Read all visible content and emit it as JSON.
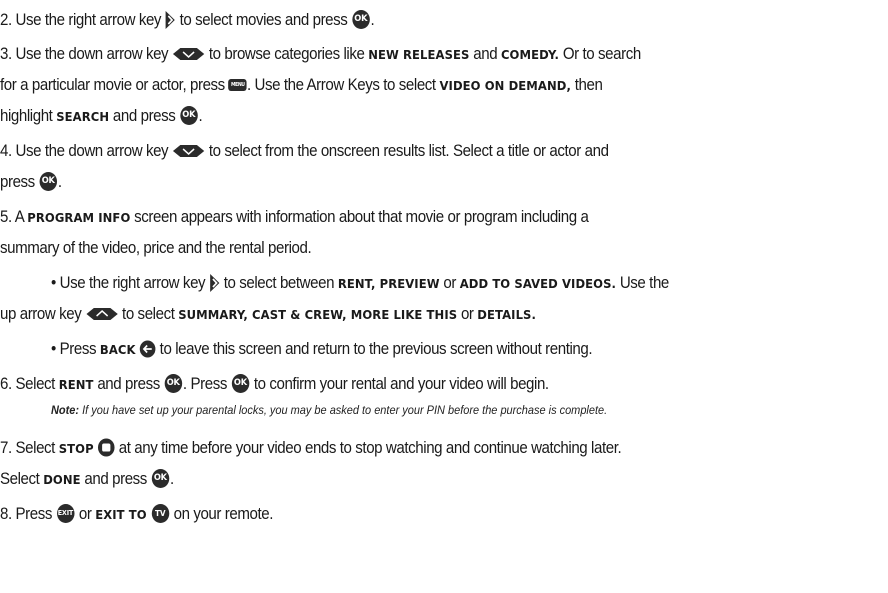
{
  "icons": {
    "ok": "OK",
    "menu": "MENU",
    "exit": "EXIT",
    "tv": "TV"
  },
  "step2": {
    "a": "2. Use the right arrow key ",
    "b": " to select movies and press ",
    "c": "."
  },
  "step3": {
    "a": "3. Use the down arrow key ",
    "b": " to browse categories like ",
    "c": "NEW RELEASES",
    "d": " and ",
    "e": "COMEDY.",
    "f": " Or to search",
    "g": "for a particular movie or actor, press ",
    "h": ". Use the Arrow Keys to select ",
    "i": "VIDEO ON DEMAND,",
    "j": " then",
    "k": "highlight ",
    "l": "SEARCH",
    "m": " and press ",
    "n": "."
  },
  "step4": {
    "a": "4. Use the down arrow key ",
    "b": " to select from the onscreen results list. Select a title or actor and",
    "c": "press ",
    "d": "."
  },
  "step5": {
    "a": "5. A ",
    "b": "PROGRAM INFO",
    "c": " screen appears with information about that movie or program including a",
    "d": "summary of the video, price and the rental period."
  },
  "bullet1": {
    "a": "• Use the right arrow key ",
    "b": " to select between ",
    "c": "RENT, PREVIEW",
    "d": " or ",
    "e": "ADD TO SAVED VIDEOS.",
    "f": " Use the",
    "g": "up arrow key ",
    "h": " to select ",
    "i": "SUMMARY, CAST & CREW, MORE LIKE THIS",
    "j": " or ",
    "k": "DETAILS."
  },
  "bullet2": {
    "a": "• Press ",
    "b": "BACK",
    "c": " to leave this screen and return to the previous screen without renting."
  },
  "step6": {
    "a": "6. Select ",
    "b": "RENT",
    "c": " and press ",
    "d": ". Press ",
    "e": " to confirm your rental and your video will begin."
  },
  "note": {
    "label": "Note:",
    "text": " If you have set up your parental locks, you may be asked to enter your PIN before the purchase is complete."
  },
  "step7": {
    "a": "7. Select ",
    "b": "STOP",
    "c": " at any time before your video ends to stop watching and continue watching later.",
    "d": "Select ",
    "e": "DONE",
    "f": " and press ",
    "g": "."
  },
  "step8": {
    "a": "8. Press ",
    "b": " or ",
    "c": "EXIT TO",
    "d": " on your remote."
  }
}
